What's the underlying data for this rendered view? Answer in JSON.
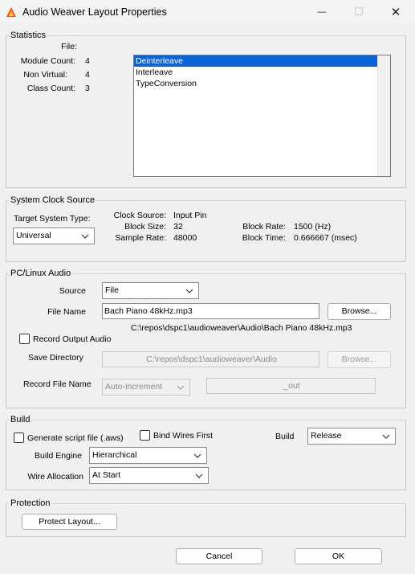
{
  "window": {
    "title": "Audio Weaver Layout Properties",
    "controls": {
      "minimize": "—",
      "maximize": "☐",
      "close": "✕"
    }
  },
  "statistics": {
    "title": "Statistics",
    "file_label": "File:",
    "file_value": "",
    "module_count_label": "Module Count:",
    "module_count": "4",
    "non_virtual_label": "Non Virtual:",
    "non_virtual": "4",
    "class_count_label": "Class Count:",
    "class_count": "3",
    "classes": [
      "Deinterleave",
      "Interleave",
      "TypeConversion"
    ],
    "selected_index": 0
  },
  "clock": {
    "title": "System Clock Source",
    "target_type_label": "Target System Type:",
    "target_type": "Universal",
    "clock_source_label": "Clock Source:",
    "clock_source": "Input Pin",
    "block_size_label": "Block Size:",
    "block_size": "32",
    "sample_rate_label": "Sample Rate:",
    "sample_rate": "48000",
    "block_rate_label": "Block Rate:",
    "block_rate": "1500 (Hz)",
    "block_time_label": "Block Time:",
    "block_time": "0.666667 (msec)"
  },
  "audio": {
    "title": "PC/Linux Audio",
    "source_label": "Source",
    "source": "File",
    "file_name_label": "File Name",
    "file_name": "Bach Piano 48kHz.mp3",
    "browse_label": "Browse...",
    "file_path": "C:\\repos\\dspc1\\audioweaver\\Audio\\Bach Piano 48kHz.mp3",
    "record_output_label": "Record Output Audio",
    "record_output_checked": false,
    "save_directory_label": "Save Directory",
    "save_directory": "C:\\repos\\dspc1\\audioweaver\\Audio",
    "browse2_label": "Browse...",
    "record_file_name_label": "Record File Name",
    "record_file_mode": "Auto-increment",
    "record_suffix": "_out"
  },
  "build": {
    "title": "Build",
    "generate_script_label": "Generate script file (.aws)",
    "generate_script_checked": false,
    "bind_wires_label": "Bind Wires First",
    "bind_wires_checked": false,
    "build_label": "Build",
    "build_value": "Release",
    "engine_label": "Build Engine",
    "engine_value": "Hierarchical",
    "wire_alloc_label": "Wire Allocation",
    "wire_alloc_value": "At Start"
  },
  "protection": {
    "title": "Protection",
    "protect_label": "Protect Layout..."
  },
  "footer": {
    "cancel_label": "Cancel",
    "ok_label": "OK"
  },
  "colors": {
    "selection": "#0a64d8",
    "background": "#f0f0f0"
  }
}
